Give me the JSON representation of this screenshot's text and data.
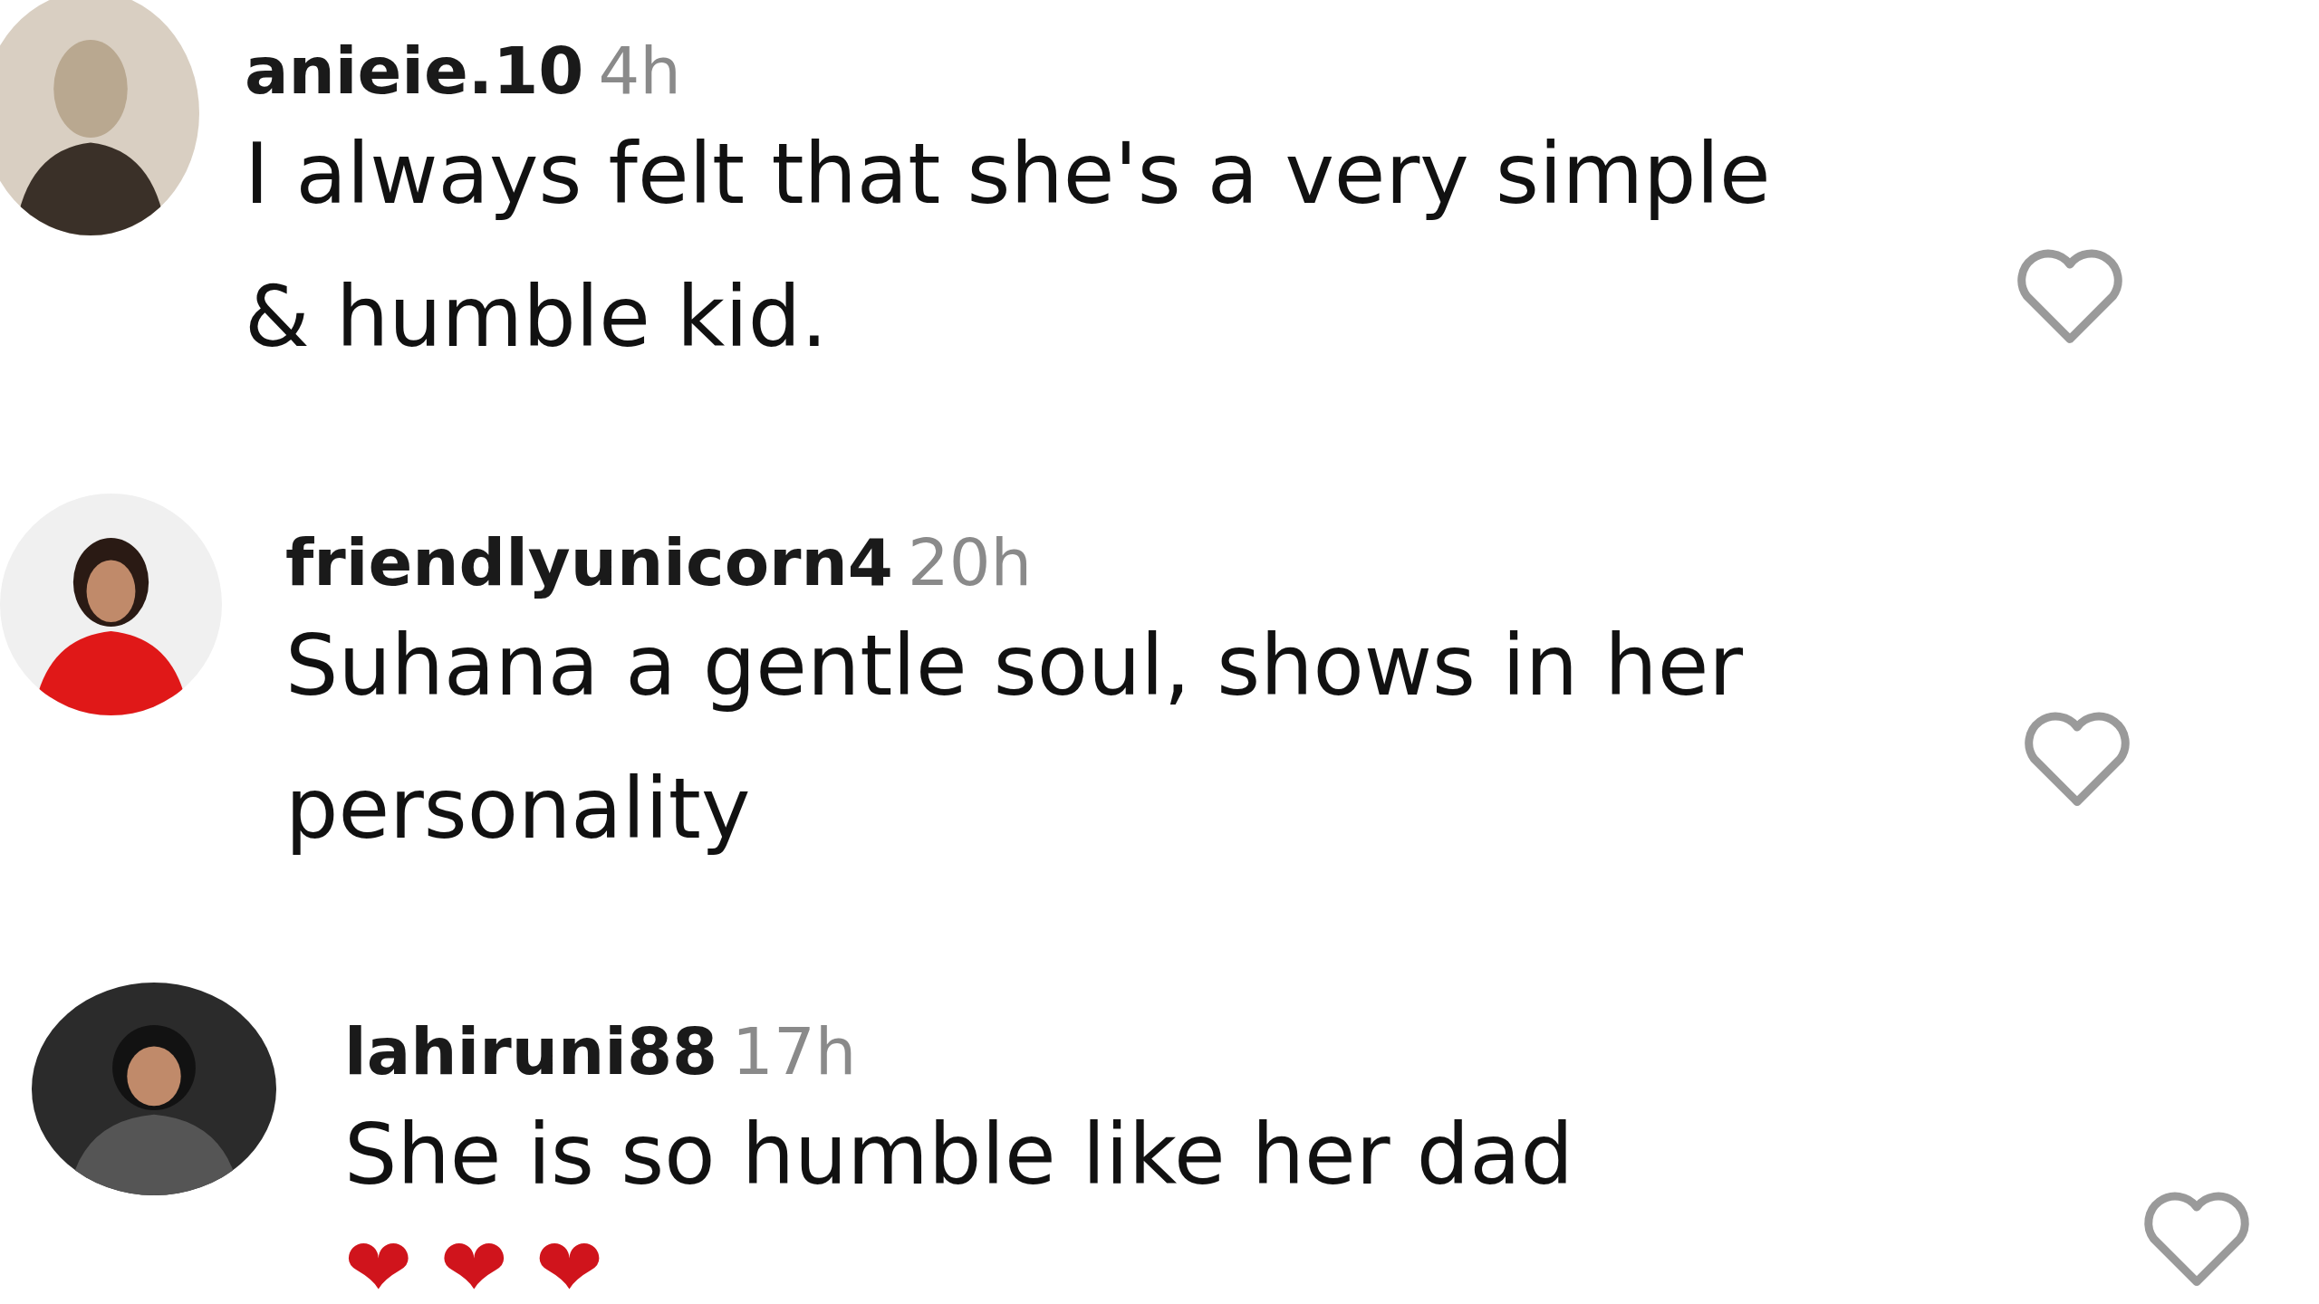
{
  "comments": [
    {
      "username": "anieie.10",
      "time": "4h",
      "text": "I always felt that she's a very simple & humble kid.",
      "liked": false
    },
    {
      "username": "friendlyunicorn4",
      "time": "20h",
      "text": "Suhana a gentle soul, shows in her personality",
      "liked": false
    },
    {
      "username": "lahiruni88",
      "time": "17h",
      "text": "She is so humble like her dad",
      "emoji": "❤❤❤",
      "liked": false
    }
  ]
}
